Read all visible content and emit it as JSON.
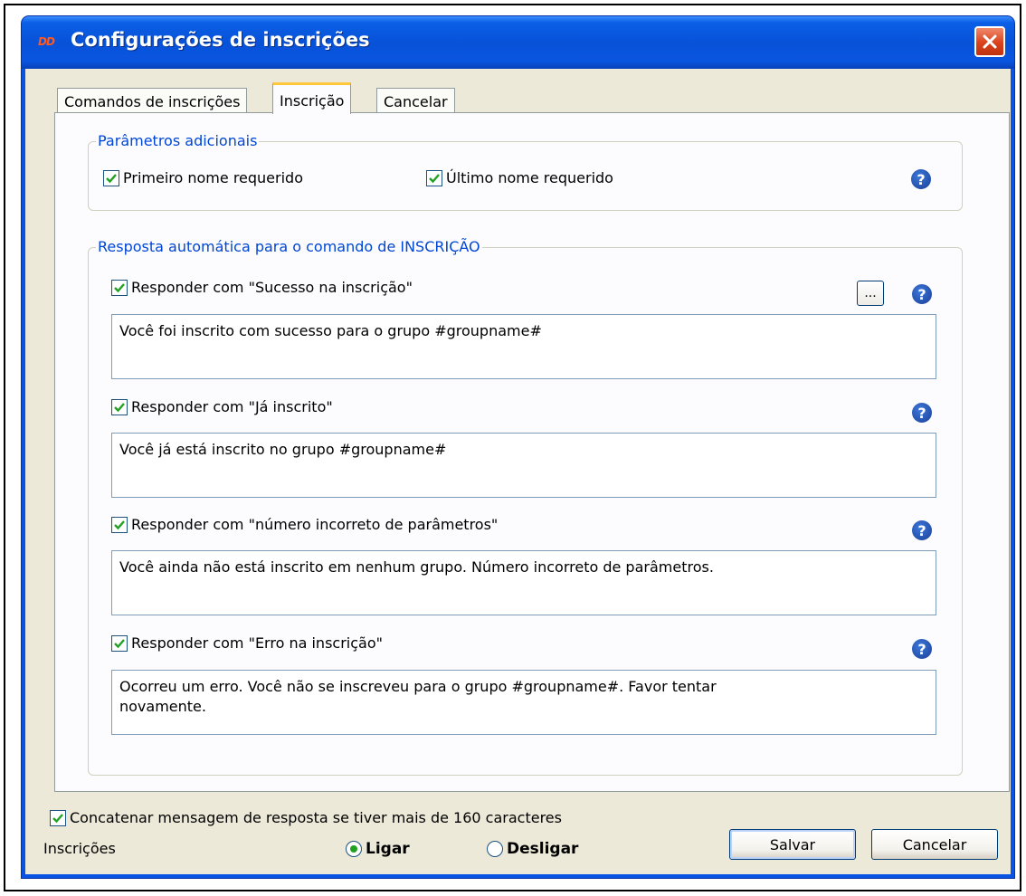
{
  "window": {
    "logo": "DD",
    "title": "Configurações de inscrições"
  },
  "tabs": [
    {
      "label": "Comandos de inscrições",
      "active": false
    },
    {
      "label": "Inscrição",
      "active": true
    },
    {
      "label": "Cancelar",
      "active": false
    }
  ],
  "additional_params": {
    "title": "Parâmetros adicionais",
    "first_name": {
      "label": "Primeiro nome requerido",
      "checked": true
    },
    "last_name": {
      "label": "Último nome requerido",
      "checked": true
    }
  },
  "auto_reply": {
    "title": "Resposta automática para o comando de INSCRIÇÃO",
    "ellipsis_label": "...",
    "items": [
      {
        "label": "Responder com \"Sucesso na inscrição\"",
        "checked": true,
        "text": "Você foi inscrito com sucesso para o grupo #groupname#"
      },
      {
        "label": "Responder com \"Já inscrito\"",
        "checked": true,
        "text": "Você já está inscrito no grupo #groupname#"
      },
      {
        "label": "Responder com \"número incorreto de parâmetros\"",
        "checked": true,
        "text": "Você ainda não está inscrito em nenhum grupo. Número incorreto de parâmetros."
      },
      {
        "label": "Responder com \"Erro na inscrição\"",
        "checked": true,
        "text": "Ocorreu um erro. Você não se inscreveu para o grupo #groupname#. Favor tentar\nnovamente."
      }
    ]
  },
  "footer": {
    "concat": {
      "label": "Concatenar mensagem de resposta se tiver mais de 160 caracteres",
      "checked": true
    },
    "subscriptions_label": "Inscrições",
    "radio_on": {
      "label": "Ligar",
      "selected": true
    },
    "radio_off": {
      "label": "Desligar",
      "selected": false
    },
    "save_label": "Salvar",
    "cancel_label": "Cancelar"
  },
  "help_glyph": "?",
  "colors": {
    "titlebar": "#0a55e0",
    "client": "#ece9d8",
    "group_title": "#0046d5",
    "check": "#21a121",
    "tab_highlight": "#ffc83c"
  }
}
